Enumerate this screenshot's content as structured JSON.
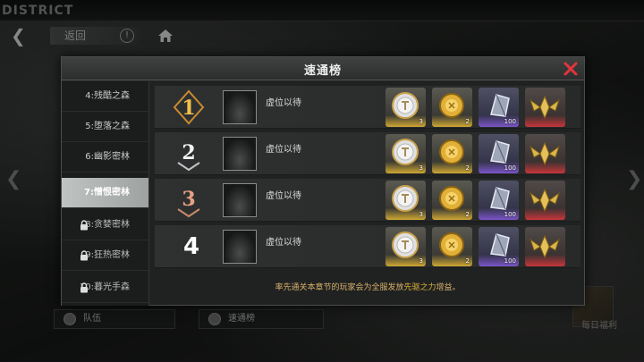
{
  "background": {
    "district_label": "DISTRICT",
    "back_label": "返回",
    "bottom_buttons": [
      {
        "label": "队伍"
      },
      {
        "label": "速通榜"
      }
    ],
    "right_label": "每日福利"
  },
  "modal": {
    "title": "速通榜",
    "sidebar": [
      {
        "label": "4:残酷之森",
        "locked": false,
        "active": false
      },
      {
        "label": "5:堕落之森",
        "locked": false,
        "active": false
      },
      {
        "label": "6:幽影密林",
        "locked": false,
        "active": false
      },
      {
        "label": "7:憎恨密林",
        "locked": false,
        "active": true
      },
      {
        "label": "8:贪婪密林",
        "locked": true,
        "active": false
      },
      {
        "label": "9:狂热密林",
        "locked": true,
        "active": false
      },
      {
        "label": "10:暮光手森",
        "locked": true,
        "active": false
      }
    ],
    "ranks": [
      {
        "rank": "1",
        "name": "虚位以待",
        "rewards": [
          {
            "qty": "3"
          },
          {
            "qty": "2"
          },
          {
            "qty": "100"
          },
          {
            "qty": ""
          }
        ]
      },
      {
        "rank": "2",
        "name": "虚位以待",
        "rewards": [
          {
            "qty": "3"
          },
          {
            "qty": "2"
          },
          {
            "qty": "100"
          },
          {
            "qty": ""
          }
        ]
      },
      {
        "rank": "3",
        "name": "虚位以待",
        "rewards": [
          {
            "qty": "3"
          },
          {
            "qty": "2"
          },
          {
            "qty": "100"
          },
          {
            "qty": ""
          }
        ]
      },
      {
        "rank": "4",
        "name": "虚位以待",
        "rewards": [
          {
            "qty": "3"
          },
          {
            "qty": "2"
          },
          {
            "qty": "100"
          },
          {
            "qty": ""
          }
        ]
      }
    ],
    "footer": {
      "prefix": "率先通关本章节的玩家会为全服发放",
      "highlight": "先驱之力",
      "suffix": "增益。"
    }
  },
  "colors": {
    "accent_red": "#e2353a",
    "gold": "#cfa733",
    "purple": "#7a55c8",
    "highlight_text": "#e0b23a"
  }
}
